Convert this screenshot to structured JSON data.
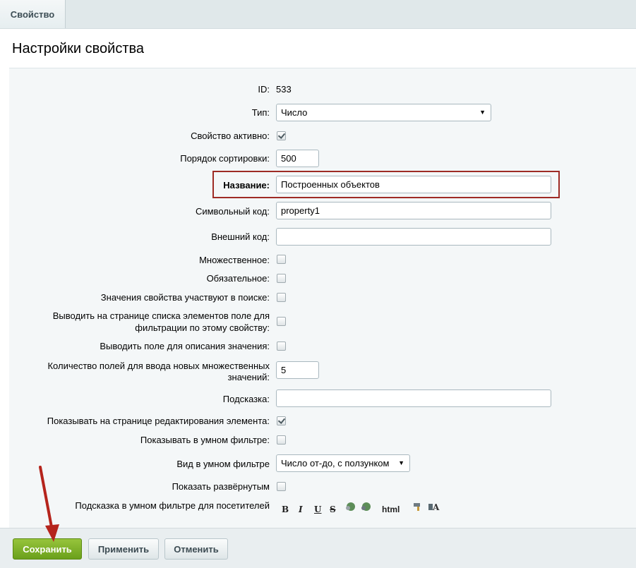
{
  "tabs": [
    {
      "label": "Свойство"
    }
  ],
  "title": "Настройки свойства",
  "fields": {
    "id": {
      "label": "ID:",
      "value": "533"
    },
    "type": {
      "label": "Тип:",
      "value": "Число"
    },
    "active": {
      "label": "Свойство активно:",
      "checked": true
    },
    "sort": {
      "label": "Порядок сортировки:",
      "value": "500"
    },
    "name": {
      "label": "Название:",
      "value": "Построенных объектов"
    },
    "code": {
      "label": "Символьный код:",
      "value": "property1"
    },
    "xml_id": {
      "label": "Внешний код:",
      "value": ""
    },
    "multiple": {
      "label": "Множественное:",
      "checked": false
    },
    "required": {
      "label": "Обязательное:",
      "checked": false
    },
    "searchable": {
      "label": "Значения свойства участвуют в поиске:",
      "checked": false
    },
    "filtrable_line1": "Выводить на странице списка элементов поле для",
    "filtrable_line2": "фильтрации по этому свойству:",
    "with_description": {
      "label": "Выводить поле для описания значения:",
      "checked": false
    },
    "multiple_cnt_line1": "Количество полей для ввода новых множественных",
    "multiple_cnt_line2": "значений:",
    "multiple_cnt": {
      "value": "5"
    },
    "hint": {
      "label": "Подсказка:",
      "value": ""
    },
    "show_on_edit": {
      "label": "Показывать на странице редактирования элемента:",
      "checked": true
    },
    "smart_filter": {
      "label": "Показывать в умном фильтре:",
      "checked": false
    },
    "smart_view": {
      "label": "Вид в умном фильтре",
      "value": "Число от-до, с ползунком"
    },
    "show_expanded": {
      "label": "Показать развёрнутым",
      "checked": false
    },
    "filter_hint": {
      "label": "Подсказка в умном фильтре для посетителей"
    }
  },
  "editor_toolbar": {
    "bold": "B",
    "italic": "I",
    "underline": "U",
    "strike": "S",
    "html": "html"
  },
  "buttons": {
    "save": "Сохранить",
    "apply": "Применить",
    "cancel": "Отменить"
  },
  "colors": {
    "save_button": "#7cb02a",
    "highlight_border": "#9e2b25",
    "annotation_arrow": "#b5241c"
  }
}
